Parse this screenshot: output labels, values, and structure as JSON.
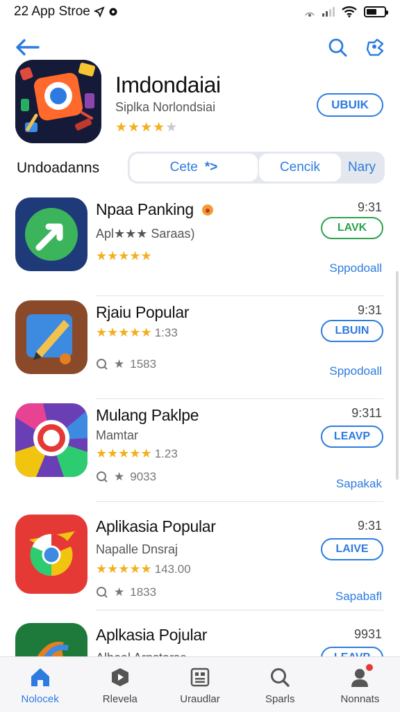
{
  "status_bar": {
    "left_text": "22 App Stroe"
  },
  "nav": {},
  "app": {
    "title": "Imdondaiai",
    "subtitle": "Siplka Norlondsiai",
    "rating_stars": 4,
    "button_label": "UBUIK"
  },
  "section": {
    "title": "Undoadanns",
    "segments": [
      {
        "label": "Cete",
        "suffix": "*>"
      },
      {
        "label": "Cencik"
      },
      {
        "label": "Nary"
      }
    ]
  },
  "list": [
    {
      "title": "Npaa Panking",
      "subtitle": "Apl★★★ Saraas)",
      "stars": "★★★★★",
      "rating_count": "",
      "meta": "",
      "time": "9:31",
      "button": "LAVK",
      "button_color": "#2ca24a",
      "link": "Sppodoall"
    },
    {
      "title": "Rjaiu Popular",
      "subtitle": "",
      "stars": "★★★★★",
      "rating_count": "1:33",
      "meta": "1583",
      "time": "9:31",
      "button": "LBUIN",
      "link": "Sppodoall"
    },
    {
      "title": "Mulang Paklpe",
      "subtitle": "Mamtar",
      "stars": "★★★★★",
      "rating_count": "1.23",
      "meta": "9033",
      "time": "9:311",
      "button": "LEAVP",
      "link": "Sapakak"
    },
    {
      "title": "Aplikasia Popular",
      "subtitle": "Napalle Dnsraj",
      "stars": "★★★★★",
      "rating_count": "143.00",
      "meta": "1833",
      "time": "9:31",
      "button": "LAIVE",
      "link": "Sapabafl"
    },
    {
      "title": "Aplkasia Pojular",
      "subtitle": "Alboal Arnstarse",
      "stars": "",
      "rating_count": "",
      "meta": "",
      "time": "9931",
      "button": "LEAVP",
      "link": ""
    }
  ],
  "tabs": [
    {
      "label": "Nolocek",
      "icon": "home-icon",
      "active": true
    },
    {
      "label": "Rlevela",
      "icon": "play-icon",
      "active": false
    },
    {
      "label": "Uraudlar",
      "icon": "grid-icon",
      "active": false
    },
    {
      "label": "Sparls",
      "icon": "search-icon",
      "active": false
    },
    {
      "label": "Nonnats",
      "icon": "person-icon",
      "active": false
    }
  ],
  "colors": {
    "accent": "#2d7be0",
    "green": "#2ca24a",
    "star": "#f2b01e",
    "badge": "#e53935"
  }
}
